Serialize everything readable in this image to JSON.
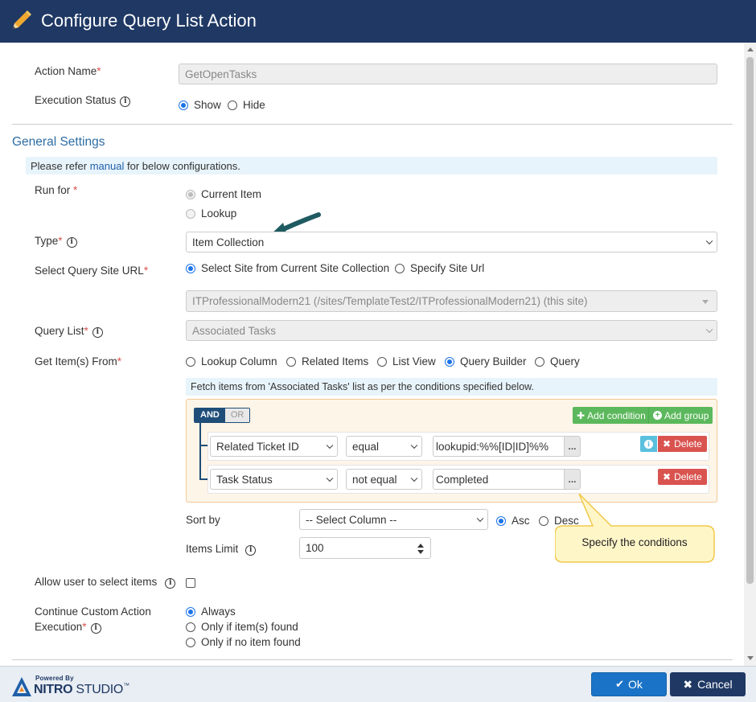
{
  "dialog": {
    "title": "Configure Query List Action"
  },
  "fields": {
    "action_name": {
      "label": "Action Name",
      "required_mark": "*",
      "value": "GetOpenTasks"
    },
    "execution_status": {
      "label": "Execution Status",
      "options": [
        "Show",
        "Hide"
      ],
      "selected": "Show"
    }
  },
  "general": {
    "heading": "General Settings",
    "note_prefix": "Please refer ",
    "note_link": "manual",
    "note_suffix": " for below configurations.",
    "run_for": {
      "label": "Run for ",
      "required_mark": "*",
      "options": [
        "Current Item",
        "Lookup"
      ],
      "selected": "Current Item"
    },
    "type": {
      "label": "Type",
      "required_mark": "*",
      "value": "Item Collection"
    },
    "site_url": {
      "label": "Select Query Site URL",
      "required_mark": "*",
      "options": [
        "Select Site from Current Site Collection",
        "Specify Site Url"
      ],
      "selected": "Select Site from Current Site Collection",
      "site_value": "ITProfessionalModern21 (/sites/TemplateTest2/ITProfessionalModern21) (this site)"
    },
    "query_list": {
      "label": "Query List",
      "required_mark": "*",
      "value": "Associated Tasks"
    },
    "get_items": {
      "label": "Get Item(s) From",
      "required_mark": "*",
      "options": [
        "Lookup Column",
        "Related Items",
        "List View",
        "Query Builder",
        "Query"
      ],
      "selected": "Query Builder"
    }
  },
  "query_builder": {
    "info": "Fetch items from 'Associated Tasks' list as per the conditions specified below.",
    "and_label": "AND",
    "or_label": "OR",
    "add_condition": "Add condition",
    "add_group": "Add group",
    "delete_label": "Delete",
    "dots_label": "...",
    "rules": [
      {
        "column": "Related Ticket ID",
        "operator": "equal",
        "value": "lookupid:%%[ID|ID]%%"
      },
      {
        "column": "Task Status",
        "operator": "not equal",
        "value": "Completed"
      }
    ]
  },
  "sort": {
    "label": "Sort by",
    "column": "-- Select Column --",
    "options": [
      "Asc",
      "Desc"
    ],
    "selected": "Asc"
  },
  "items_limit": {
    "label": "Items Limit",
    "value": "100"
  },
  "allow_select": {
    "label": "Allow user to select items",
    "checked": false
  },
  "continue_exec": {
    "label_line1": "Continue Custom Action",
    "label_line2": "Execution",
    "required_mark": "*",
    "options": [
      "Always",
      "Only if item(s) found",
      "Only if no item found"
    ],
    "selected": "Always"
  },
  "callout": {
    "text": "Specify the conditions"
  },
  "footer": {
    "powered_by": "Powered By",
    "brand_nitro": "NITRO",
    "brand_studio": " STUDIO",
    "brand_tm": "™",
    "ok_label": "Ok",
    "cancel_label": "Cancel"
  },
  "colors": {
    "header": "#1f3864",
    "accent": "#1a73e8",
    "success": "#5cb85c",
    "danger": "#d9534f",
    "callout": "#fff6c8",
    "arrow": "#1e5b61"
  }
}
